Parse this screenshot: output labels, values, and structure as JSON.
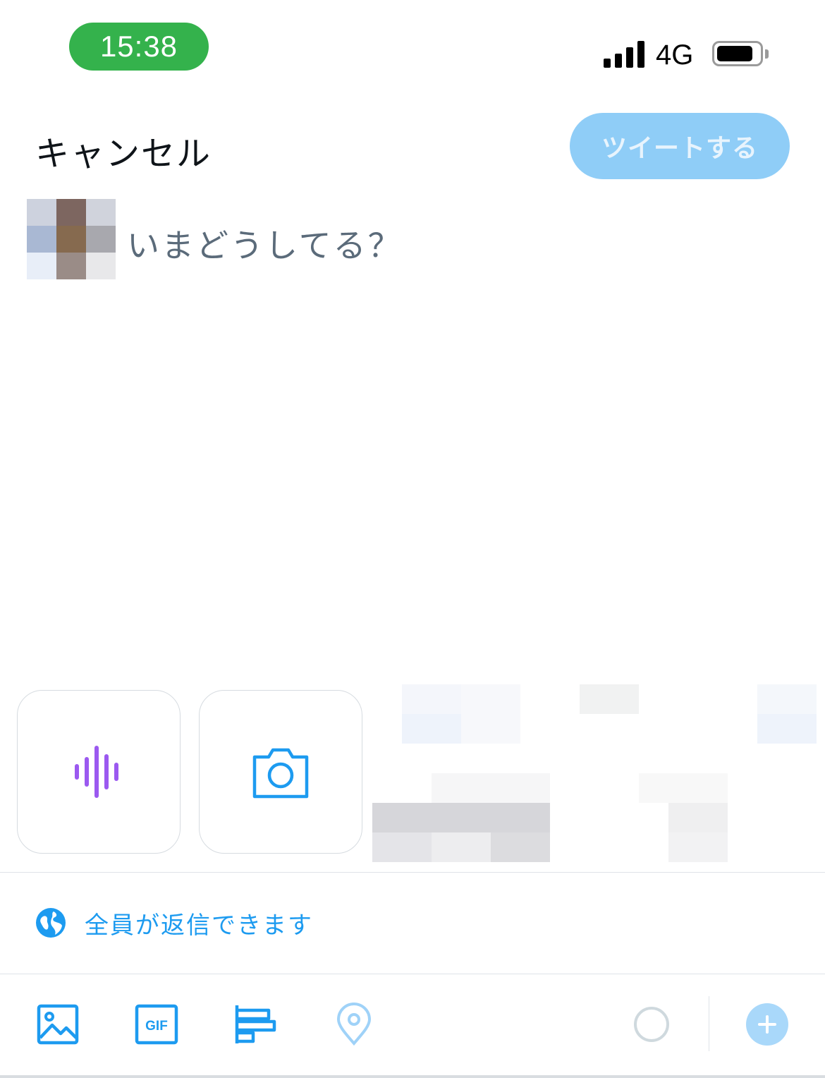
{
  "status_bar": {
    "time": "15:38",
    "network": "4G",
    "time_pill_color": "#34b24c",
    "icons": [
      "signal-bars-icon",
      "battery-icon"
    ]
  },
  "header": {
    "cancel_label": "キャンセル",
    "tweet_button_label": "ツイートする",
    "tweet_button_color": "#8fcdf7"
  },
  "composer": {
    "placeholder": "いまどうしてる？",
    "avatar": "pixelated-avatar"
  },
  "media_row": {
    "items": [
      {
        "icon": "voice-waveform-icon",
        "color": "#9b59f0"
      },
      {
        "icon": "camera-icon",
        "color": "#1d9bf0"
      }
    ],
    "thumbnails": "pixelated-photo-thumbnails"
  },
  "reply_setting": {
    "icon": "globe-icon",
    "label": "全員が返信できます",
    "color": "#1d9bf0"
  },
  "toolbar": {
    "items": [
      {
        "icon": "image-icon"
      },
      {
        "icon": "gif-icon",
        "label": "GIF"
      },
      {
        "icon": "poll-icon"
      },
      {
        "icon": "location-pin-icon"
      }
    ],
    "char_counter_icon": "progress-ring-icon",
    "add_icon": "plus-icon",
    "accent": "#1d9bf0"
  }
}
